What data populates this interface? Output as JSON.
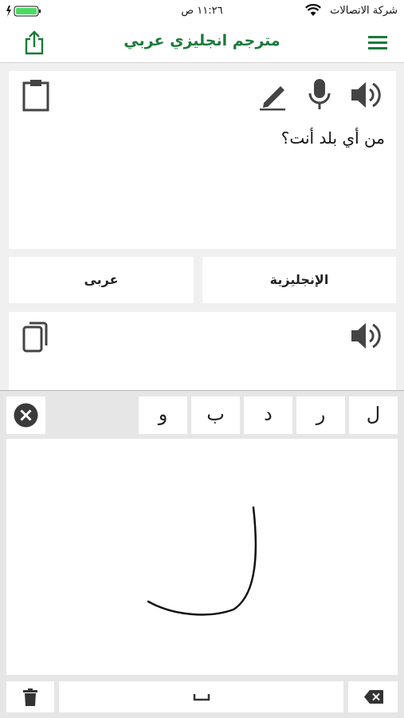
{
  "status_bar": {
    "carrier": "شركة الاتصالات",
    "time": "١١:٢٦ ص",
    "icons": [
      "wifi-icon",
      "battery-icon",
      "charging-icon"
    ]
  },
  "nav": {
    "title": "مترجم انجليزي عربي",
    "icons": [
      "share-icon",
      "menu-icon"
    ],
    "accent_color": "#1b7a3a"
  },
  "input_panel": {
    "text": "من أي بلد أنت؟",
    "icons": [
      "clipboard-icon",
      "pencil-icon",
      "microphone-icon",
      "speaker-icon"
    ]
  },
  "languages": {
    "source": "الإنجليزية",
    "target": "عربى"
  },
  "output_panel": {
    "text": "",
    "icons": [
      "copy-icon",
      "speaker-icon"
    ]
  },
  "keyboard": {
    "candidates": [
      "ل",
      "ر",
      "د",
      "ب",
      "و"
    ],
    "icons": [
      "clear-candidates-icon",
      "trash-icon",
      "space-icon",
      "backspace-icon"
    ]
  }
}
